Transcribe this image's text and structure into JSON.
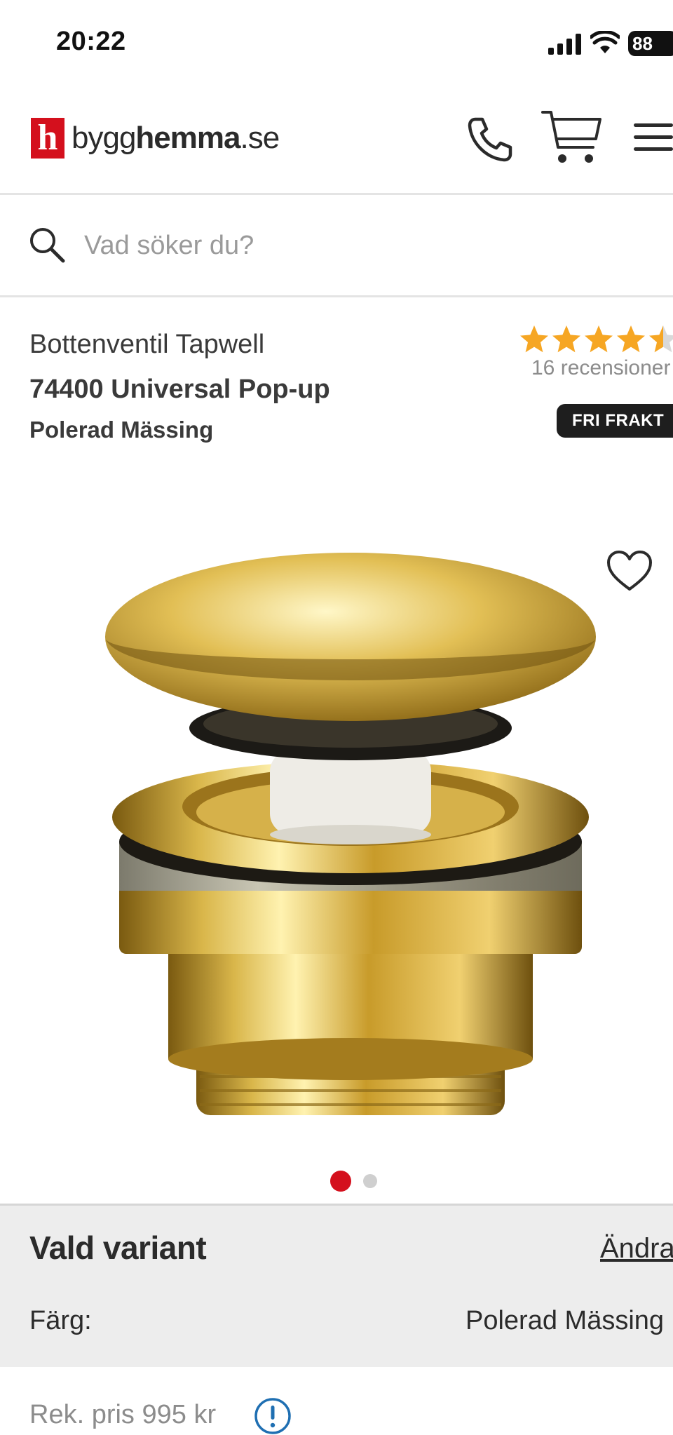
{
  "status_bar": {
    "time": "20:22",
    "battery": "88"
  },
  "header": {
    "logo_mark": "h",
    "logo_text_light": "bygg",
    "logo_text_bold": "hemma",
    "logo_text_tld": ".se",
    "icons": [
      "phone-icon",
      "cart-icon",
      "menu-icon"
    ]
  },
  "search": {
    "placeholder": "Vad söker du?"
  },
  "product": {
    "brand_line": "Bottenventil Tapwell",
    "model_line": "74400 Universal Pop-up",
    "variant_line": "Polerad Mässing",
    "rating": 4.5,
    "reviews_text": "16 recensioner",
    "badge": "FRI FRAKT",
    "image_count": 2,
    "active_image": 1
  },
  "variant": {
    "title": "Vald variant",
    "change_label": "Ändra",
    "color_label": "Färg:",
    "color_value": "Polerad Mässing"
  },
  "price": {
    "recommended": "Rek. pris 995 kr"
  },
  "colors": {
    "brand_red": "#d4101d",
    "star_gold": "#f6a623",
    "badge_dark": "#1e1e1e",
    "panel_gray": "#ededed",
    "info_blue": "#1f6fb2"
  }
}
